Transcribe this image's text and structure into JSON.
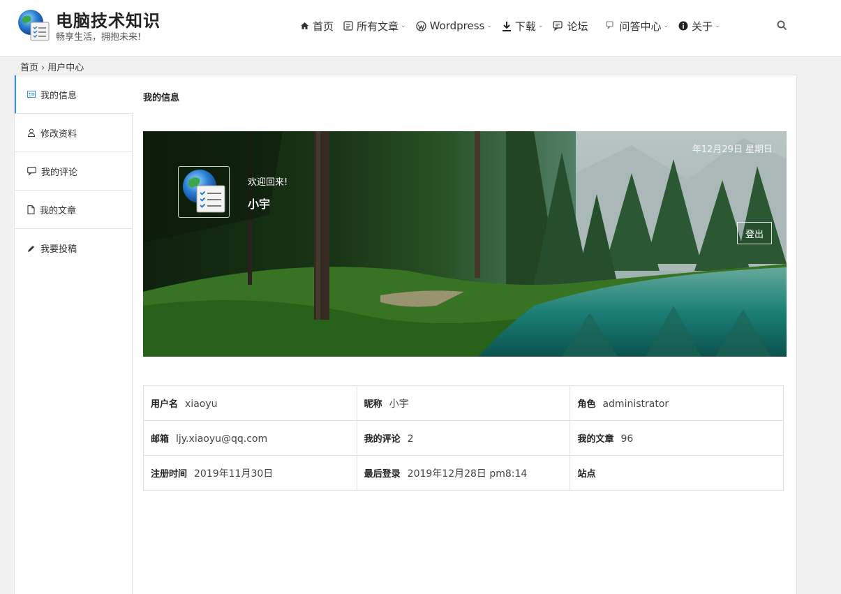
{
  "header": {
    "site_title": "电脑技术知识",
    "site_subtitle": "畅享生活，拥抱未来!",
    "nav": [
      {
        "label": "首页",
        "icon": "home-icon",
        "dropdown": false
      },
      {
        "label": "所有文章",
        "icon": "article-icon",
        "dropdown": true
      },
      {
        "label": "Wordpress",
        "icon": "wordpress-icon",
        "dropdown": true
      },
      {
        "label": "下载",
        "icon": "download-icon",
        "dropdown": true
      },
      {
        "label": "论坛",
        "icon": "forum-icon",
        "dropdown": false
      },
      {
        "label": "问答中心",
        "icon": "qa-icon",
        "dropdown": true
      },
      {
        "label": "关于",
        "icon": "info-icon",
        "dropdown": true
      }
    ]
  },
  "breadcrumb": {
    "home": "首页",
    "separator": "›",
    "current": "用户中心"
  },
  "sidebar": {
    "items": [
      {
        "label": "我的信息",
        "icon": "profile-card-icon"
      },
      {
        "label": "修改资料",
        "icon": "user-icon"
      },
      {
        "label": "我的评论",
        "icon": "comment-icon"
      },
      {
        "label": "我的文章",
        "icon": "document-icon"
      },
      {
        "label": "我要投稿",
        "icon": "pencil-icon"
      }
    ]
  },
  "main": {
    "title": "我的信息",
    "banner": {
      "date": "年12月29日 星期日",
      "welcome": "欢迎回来!",
      "nickname": "小宇",
      "logout_label": "登出"
    },
    "info": [
      [
        {
          "key": "用户名",
          "value": "xiaoyu"
        },
        {
          "key": "昵称",
          "value": "小宇"
        },
        {
          "key": "角色",
          "value": "administrator"
        }
      ],
      [
        {
          "key": "邮箱",
          "value": "ljy.xiaoyu@qq.com"
        },
        {
          "key": "我的评论",
          "value": "2"
        },
        {
          "key": "我的文章",
          "value": "96"
        }
      ],
      [
        {
          "key": "注册时间",
          "value": "2019年11月30日"
        },
        {
          "key": "最后登录",
          "value": "2019年12月28日 pm8:14"
        },
        {
          "key": "站点",
          "value": ""
        }
      ]
    ]
  },
  "colors": {
    "accent": "#2f8ff5",
    "border": "#e2e2e2"
  }
}
